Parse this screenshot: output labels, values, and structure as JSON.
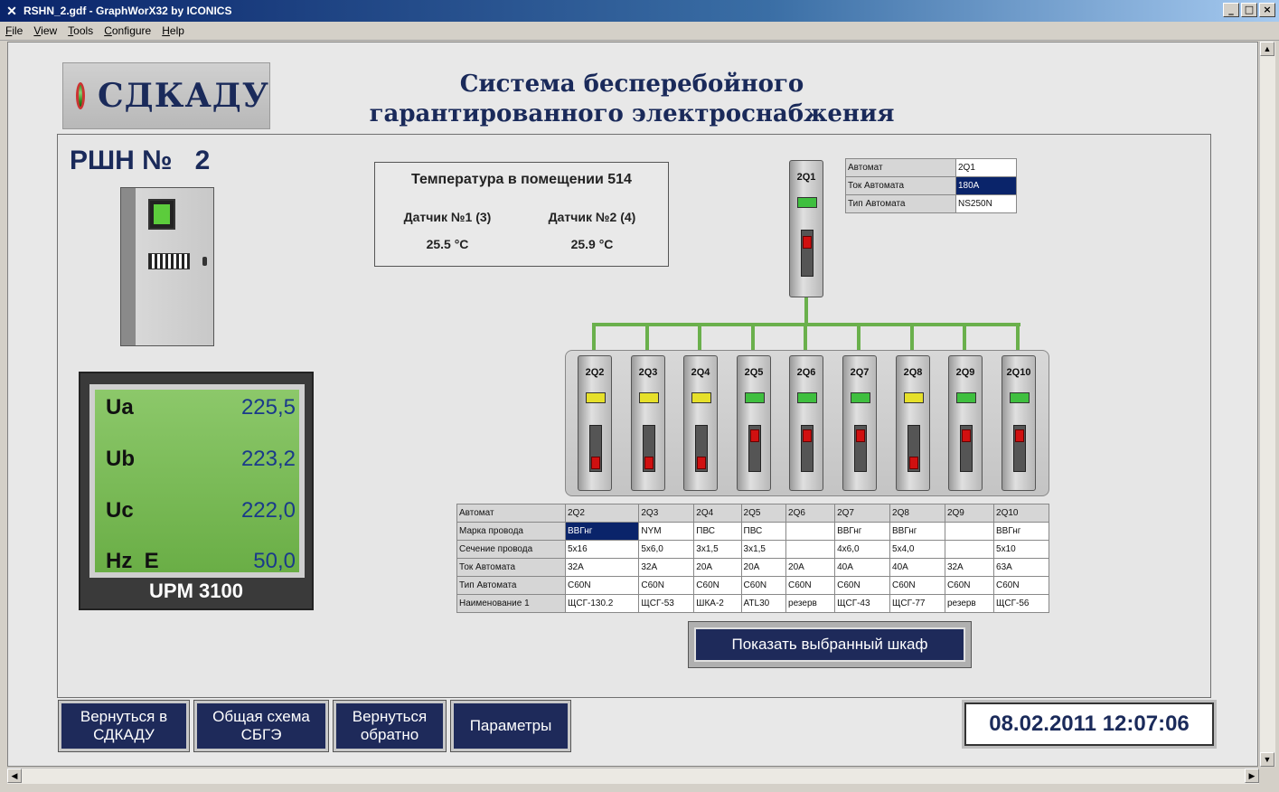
{
  "window": {
    "title": "RSHN_2.gdf - GraphWorX32 by ICONICS",
    "controls": {
      "minimize": "_",
      "maximize": "□",
      "close": "×"
    }
  },
  "menu": [
    "File",
    "View",
    "Tools",
    "Configure",
    "Help"
  ],
  "logo": {
    "text": "СДКАДУ"
  },
  "header": {
    "title_line1": "Система бесперебойного",
    "title_line2": "гарантированного электроснабжения"
  },
  "cabinet_title": "РШН №   2",
  "meter": {
    "model": "UPM 3100",
    "rows": [
      {
        "label": "Ua",
        "value": "225,5"
      },
      {
        "label": "Ub",
        "value": "223,2"
      },
      {
        "label": "Uc",
        "value": "222,0"
      },
      {
        "label": "Hz  E",
        "value": "50,0"
      }
    ]
  },
  "temperature": {
    "title": "Температура в помещении 514",
    "sensor1_label": "Датчик №1 (3)",
    "sensor1_value": "25.5 °C",
    "sensor2_label": "Датчик №2 (4)",
    "sensor2_value": "25.9 °C"
  },
  "main_breaker": {
    "name": "2Q1",
    "led_color": "#3fbf3f",
    "info": [
      {
        "label": "Автомат",
        "value": "2Q1"
      },
      {
        "label": "Ток Автомата",
        "value": "180A"
      },
      {
        "label": "Тип Автомата",
        "value": "NS250N"
      }
    ]
  },
  "breakers": [
    {
      "name": "2Q2",
      "led": "#e6e02a",
      "lever": "low"
    },
    {
      "name": "2Q3",
      "led": "#e6e02a",
      "lever": "low"
    },
    {
      "name": "2Q4",
      "led": "#e6e02a",
      "lever": "low"
    },
    {
      "name": "2Q5",
      "led": "#3fbf3f",
      "lever": "high"
    },
    {
      "name": "2Q6",
      "led": "#3fbf3f",
      "lever": "high"
    },
    {
      "name": "2Q7",
      "led": "#3fbf3f",
      "lever": "high"
    },
    {
      "name": "2Q8",
      "led": "#e6e02a",
      "lever": "low"
    },
    {
      "name": "2Q9",
      "led": "#3fbf3f",
      "lever": "high"
    },
    {
      "name": "2Q10",
      "led": "#3fbf3f",
      "lever": "high"
    }
  ],
  "feeder_table": {
    "row_labels": [
      "Автомат",
      "Марка провода",
      "Сечение провода",
      "Ток Автомата",
      "Тип Автомата",
      "Наименование 1"
    ],
    "columns": [
      [
        "2Q2",
        "ВВГнг",
        "5х16",
        "32А",
        "C60N",
        "ЩСГ-130.2"
      ],
      [
        "2Q3",
        "NYM",
        "5х6,0",
        "32А",
        "C60N",
        "ЩСГ-53"
      ],
      [
        "2Q4",
        "ПВС",
        "3х1,5",
        "20А",
        "C60N",
        "ШКА-2"
      ],
      [
        "2Q5",
        "ПВС",
        "3х1,5",
        "20А",
        "C60N",
        "АТL30"
      ],
      [
        "2Q6",
        "",
        "",
        "20А",
        "C60N",
        "резерв"
      ],
      [
        "2Q7",
        "ВВГнг",
        "4х6,0",
        "40А",
        "C60N",
        "ЩСГ-43"
      ],
      [
        "2Q8",
        "ВВГнг",
        "5х4,0",
        "40А",
        "C60N",
        "ЩСГ-77"
      ],
      [
        "2Q9",
        "",
        "",
        "32А",
        "C60N",
        "резерв"
      ],
      [
        "2Q10",
        "ВВГнг",
        "5х10",
        "63А",
        "C60N",
        "ЩСГ-56"
      ]
    ]
  },
  "buttons": {
    "show_cabinet": "Показать выбранный шкаф",
    "back_sdkadu": "Вернуться в СДКАДУ",
    "general_scheme": "Общая схема СБГЭ",
    "go_back": "Вернуться обратно",
    "params": "Параметры"
  },
  "datetime": "08.02.2011 12:07:06",
  "colors": {
    "accent": "#1e2a5a",
    "bus": "#6ab04c",
    "selected": "#0a246a"
  }
}
